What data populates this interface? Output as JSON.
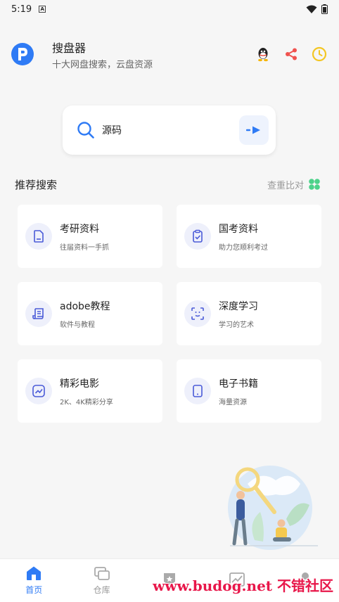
{
  "status_bar": {
    "time": "5:19",
    "sim_label": "A"
  },
  "header": {
    "title": "搜盘器",
    "subtitle": "十大网盘搜索，云盘资源",
    "logo_letter": "P"
  },
  "search": {
    "value": "源码"
  },
  "section": {
    "title": "推荐搜索",
    "link_label": "查重比对"
  },
  "cards": [
    {
      "title": "考研资料",
      "subtitle": "往届资料一手抓",
      "icon": "document-icon"
    },
    {
      "title": "国考资料",
      "subtitle": "助力您顺利考过",
      "icon": "clipboard-check-icon"
    },
    {
      "title": "adobe教程",
      "subtitle": "软件与教程",
      "icon": "script-icon"
    },
    {
      "title": "深度学习",
      "subtitle": "学习的艺术",
      "icon": "face-scan-icon"
    },
    {
      "title": "精彩电影",
      "subtitle": "2K、4K精彩分享",
      "icon": "trend-chart-icon"
    },
    {
      "title": "电子书籍",
      "subtitle": "海量资源",
      "icon": "tablet-icon"
    }
  ],
  "nav": [
    {
      "label": "首页",
      "icon": "home-icon",
      "active": true
    },
    {
      "label": "仓库",
      "icon": "folders-icon",
      "active": false
    },
    {
      "label": "",
      "icon": "badge-icon",
      "active": false
    },
    {
      "label": "",
      "icon": "chart-icon",
      "active": false
    },
    {
      "label": "",
      "icon": "user-icon",
      "active": false
    }
  ],
  "watermark": "www.budog.net 不错社区",
  "colors": {
    "accent": "#2f7bf5",
    "share": "#f0524e",
    "clock": "#f3c623",
    "clover": "#4cd28a"
  }
}
